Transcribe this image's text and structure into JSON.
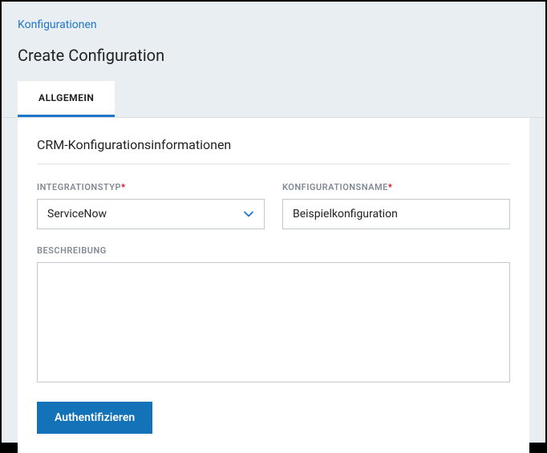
{
  "breadcrumb": {
    "label": "Konfigurationen"
  },
  "page": {
    "title": "Create Configuration"
  },
  "tabs": {
    "active_label": "ALLGEMEIN"
  },
  "section": {
    "title": "CRM-Konfigurationsinformationen"
  },
  "fields": {
    "integration_type": {
      "label": "INTEGRATIONSTYP",
      "value": "ServiceNow"
    },
    "config_name": {
      "label": "KONFIGURATIONSNAME",
      "value": "Beispielkonfiguration"
    },
    "description": {
      "label": "BESCHREIBUNG",
      "value": ""
    }
  },
  "buttons": {
    "authenticate": "Authentifizieren"
  }
}
